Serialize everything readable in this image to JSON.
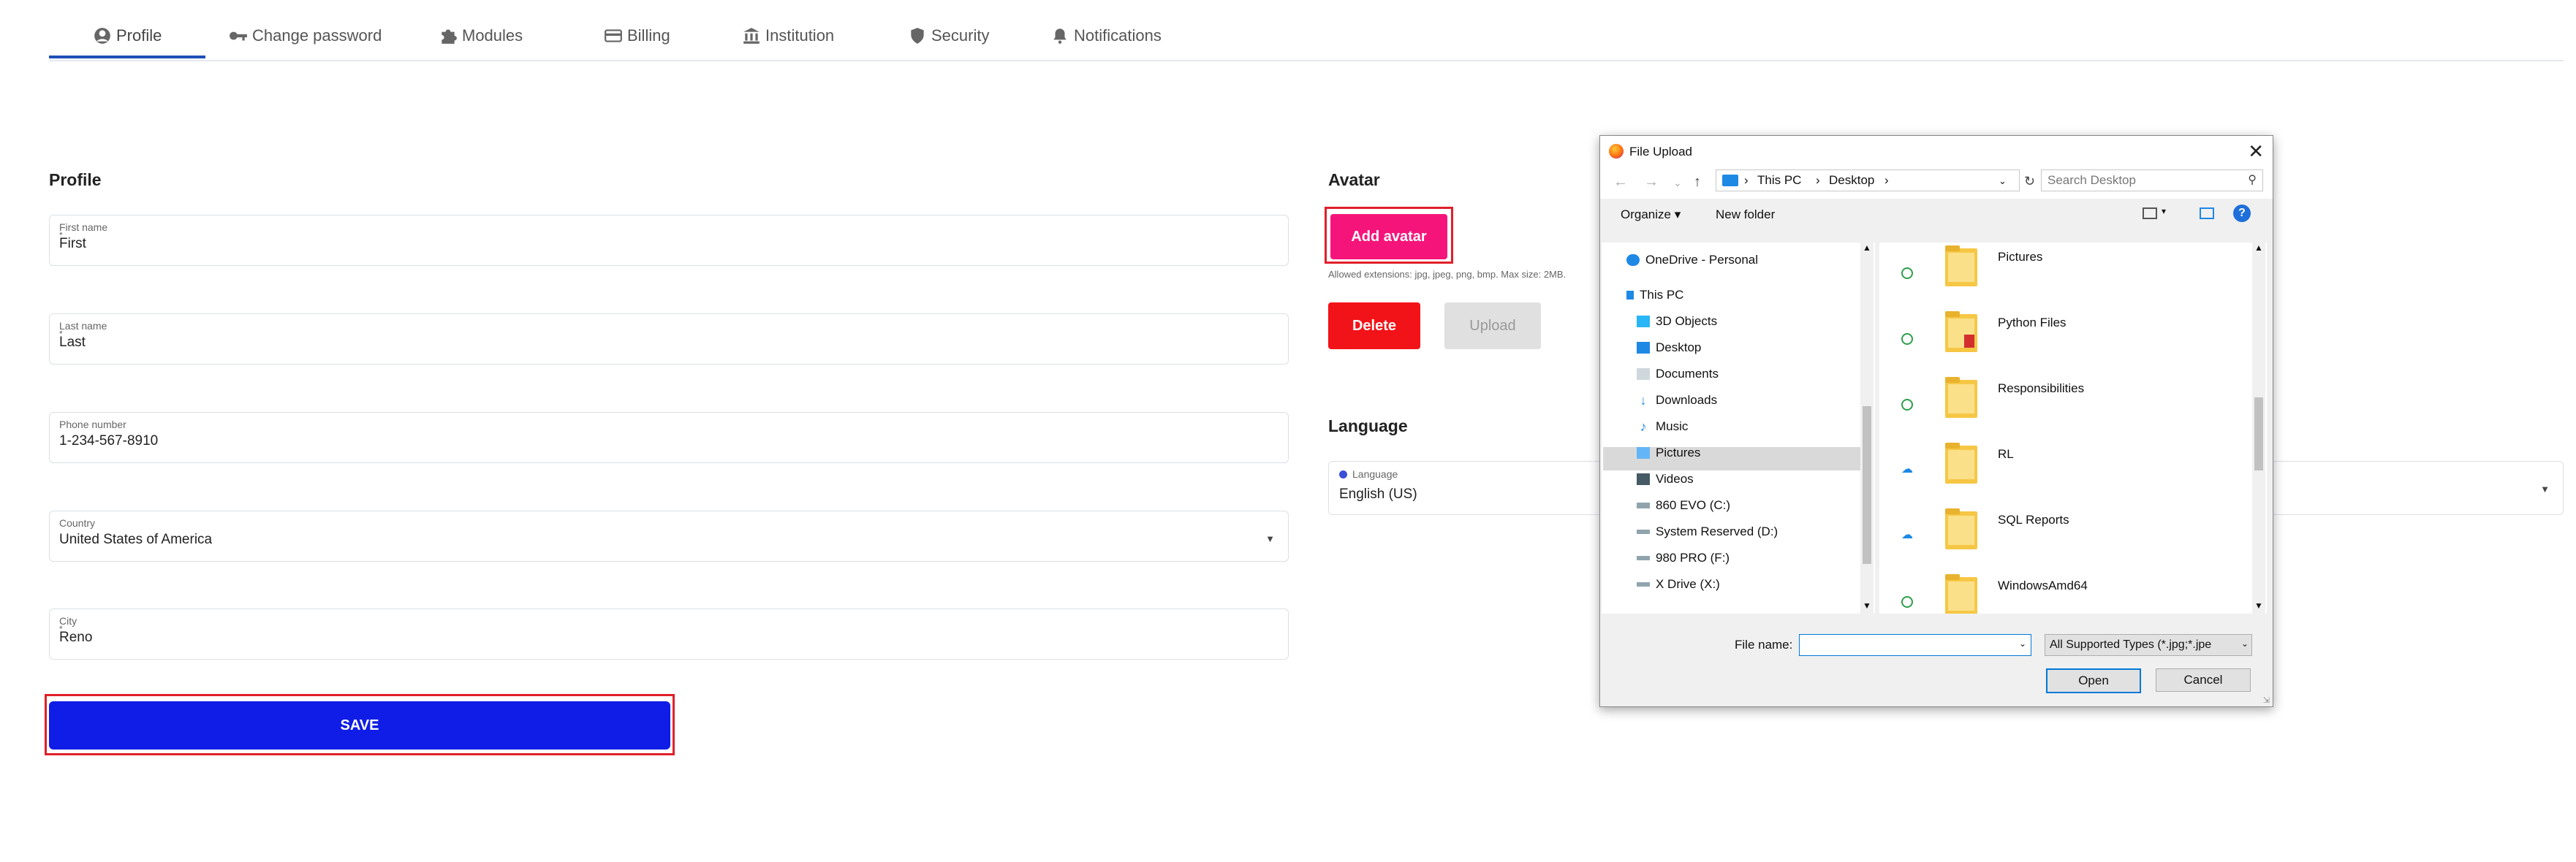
{
  "tabs": [
    {
      "label": "Profile",
      "icon": "user-circle-icon"
    },
    {
      "label": "Change password",
      "icon": "key-icon"
    },
    {
      "label": "Modules",
      "icon": "puzzle-icon"
    },
    {
      "label": "Billing",
      "icon": "credit-card-icon"
    },
    {
      "label": "Institution",
      "icon": "institution-icon"
    },
    {
      "label": "Security",
      "icon": "shield-icon"
    },
    {
      "label": "Notifications",
      "icon": "bell-icon"
    }
  ],
  "profile": {
    "title": "Profile",
    "fields": {
      "first_name": {
        "label": "First name",
        "required_mark": "*",
        "value": "First"
      },
      "last_name": {
        "label": "Last name",
        "required_mark": "*",
        "value": "Last"
      },
      "phone": {
        "label": "Phone number",
        "value": "1-234-567-8910"
      },
      "country": {
        "label": "Country",
        "value": "United States of America"
      },
      "city": {
        "label": "City",
        "required_mark": "*",
        "value": "Reno"
      }
    },
    "save_label": "SAVE"
  },
  "avatar": {
    "title": "Avatar",
    "add_label": "Add avatar",
    "allowed": "Allowed extensions: jpg, jpeg, png, bmp. Max size: 2MB.",
    "delete_label": "Delete",
    "upload_label": "Upload"
  },
  "language": {
    "title": "Language",
    "label": "Language",
    "value": "English (US)"
  },
  "dialog": {
    "title": "File Upload",
    "path": [
      "This PC",
      "Desktop"
    ],
    "search_placeholder": "Search Desktop",
    "organize_label": "Organize",
    "new_folder_label": "New folder",
    "nav_items": [
      {
        "label": "OneDrive - Personal",
        "icon": "onedrive-icon"
      },
      {
        "label": "This PC",
        "icon": "computer-icon"
      },
      {
        "label": "3D Objects",
        "icon": "3d-objects-icon"
      },
      {
        "label": "Desktop",
        "icon": "desktop-icon"
      },
      {
        "label": "Documents",
        "icon": "documents-icon"
      },
      {
        "label": "Downloads",
        "icon": "downloads-icon"
      },
      {
        "label": "Music",
        "icon": "music-icon"
      },
      {
        "label": "Pictures",
        "icon": "pictures-icon"
      },
      {
        "label": "Videos",
        "icon": "videos-icon"
      },
      {
        "label": "860 EVO (C:)",
        "icon": "drive-icon"
      },
      {
        "label": "System Reserved (D:)",
        "icon": "drive-icon"
      },
      {
        "label": "980 PRO (F:)",
        "icon": "drive-icon"
      },
      {
        "label": "X Drive (X:)",
        "icon": "drive-icon"
      }
    ],
    "files": [
      {
        "name": "Pictures",
        "status": "synced"
      },
      {
        "name": "Python Files",
        "status": "synced"
      },
      {
        "name": "Responsibilities",
        "status": "synced"
      },
      {
        "name": "RL",
        "status": "cloud"
      },
      {
        "name": "SQL Reports",
        "status": "cloud"
      },
      {
        "name": "WindowsAmd64",
        "status": "synced"
      }
    ],
    "file_name_label": "File name:",
    "file_name_value": "",
    "filter_value": "All Supported Types (*.jpg;*.jpe",
    "open_label": "Open",
    "cancel_label": "Cancel"
  },
  "colors": {
    "tab_accent": "#1d4fb8",
    "save": "#0f1de6",
    "add_avatar": "#f5157a",
    "delete": "#f21318",
    "highlight_border": "#e0202a"
  }
}
